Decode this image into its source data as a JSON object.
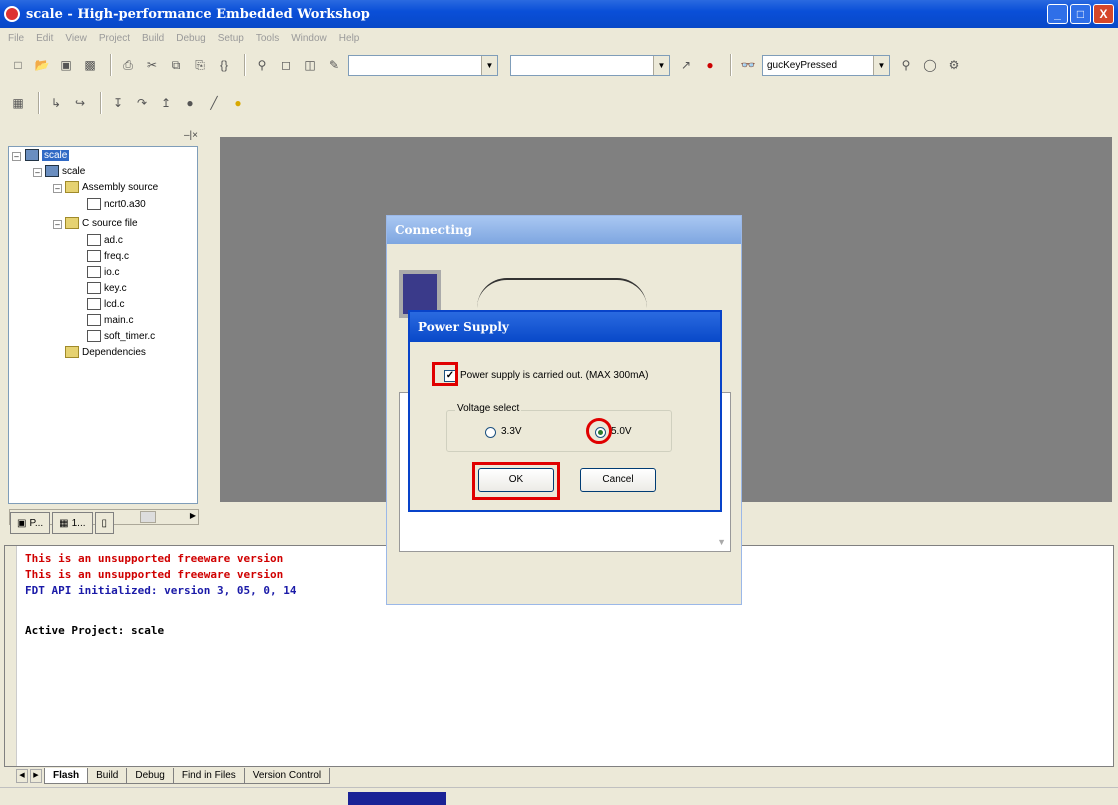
{
  "window": {
    "title": "scale - High-performance Embedded Workshop",
    "controls": [
      "_",
      "□",
      "X"
    ]
  },
  "menu": [
    "File",
    "Edit",
    "View",
    "Project",
    "Build",
    "Debug",
    "Setup",
    "Tools",
    "Window",
    "Help"
  ],
  "toolbar": {
    "watch_combo_value": "gucKeyPressed"
  },
  "workspace": {
    "close_label": "–|×",
    "tree": {
      "root": "scale",
      "project": "scale",
      "assembly_folder": "Assembly source",
      "assembly_files": [
        "ncrt0.a30"
      ],
      "c_folder": "C source file",
      "c_files": [
        "ad.c",
        "freq.c",
        "io.c",
        "key.c",
        "lcd.c",
        "main.c",
        "soft_timer.c"
      ],
      "dependencies": "Dependencies"
    },
    "tabs": [
      "P...",
      "1...",
      ""
    ]
  },
  "output": {
    "lines": [
      {
        "text": "This is an unsupported freeware version",
        "color": "#d00000"
      },
      {
        "text": "This is an unsupported freeware version",
        "color": "#d00000"
      },
      {
        "text": "FDT API initialized: version 3, 05, 0, 14",
        "color": "#1a1aa8"
      },
      {
        "text": "",
        "color": "#000000"
      },
      {
        "text": "Active Project: scale",
        "color": "#000000"
      }
    ],
    "tabs": [
      "Flash",
      "Build",
      "Debug",
      "Find in Files",
      "Version Control"
    ],
    "active_tab": "Flash"
  },
  "dialogs": {
    "connecting": {
      "title": "Connecting"
    },
    "power_supply": {
      "title": "Power Supply",
      "checkbox_label": "Power supply is carried out. (MAX 300mA)",
      "checkbox_checked": true,
      "voltage_group_label": "Voltage select",
      "options": [
        "3.3V",
        "5.0V"
      ],
      "selected_option": "5.0V",
      "ok_label": "OK",
      "cancel_label": "Cancel",
      "highlight_color": "#e00000"
    }
  }
}
